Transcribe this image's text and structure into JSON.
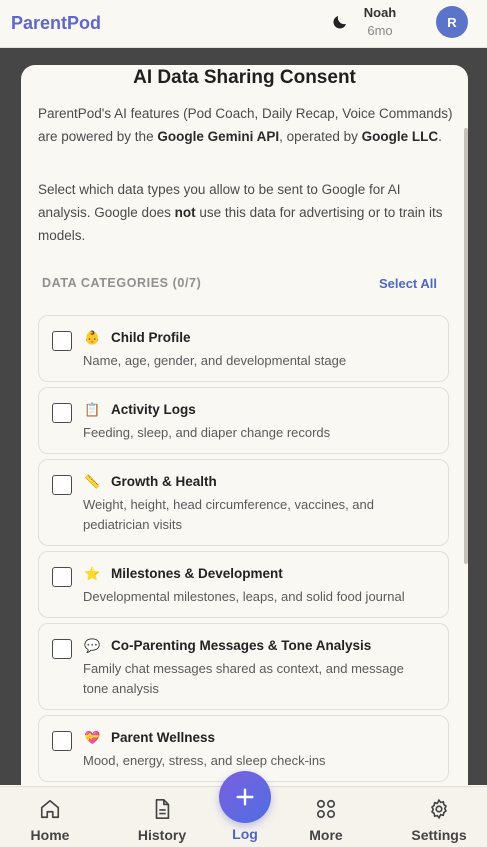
{
  "header": {
    "brand": "ParentPod",
    "user_name": "Noah",
    "child_age": "6mo",
    "avatar_initial": "R",
    "theme_icon": "moon-icon"
  },
  "modal": {
    "title": "AI Data Sharing Consent",
    "intro_pre": "ParentPod's AI features (Pod Coach, Daily Recap, Voice Commands) are powered by the ",
    "intro_api": "Google Gemini API",
    "intro_mid": ", operated by ",
    "intro_company": "Google LLC",
    "intro_end": ".",
    "select_pre": "Select which data types you allow to be sent to Google for AI analysis. Google does ",
    "select_not": "not",
    "select_post": " use this data for advertising or to train its models.",
    "categories_heading": "DATA CATEGORIES (0/7)",
    "select_all": "Select All",
    "categories": [
      {
        "emoji": "👶",
        "title": "Child Profile",
        "desc": "Name, age, gender, and developmental stage",
        "checked": false
      },
      {
        "emoji": "📋",
        "title": "Activity Logs",
        "desc": "Feeding, sleep, and diaper change records",
        "checked": false
      },
      {
        "emoji": "📏",
        "title": "Growth & Health",
        "desc": "Weight, height, head circumference, vaccines, and pediatrician visits",
        "checked": false
      },
      {
        "emoji": "⭐",
        "title": "Milestones & Development",
        "desc": "Developmental milestones, leaps, and solid food journal",
        "checked": false
      },
      {
        "emoji": "💬",
        "title": "Co-Parenting Messages & Tone Analysis",
        "desc": "Family chat messages shared as context, and message tone analysis",
        "checked": false
      },
      {
        "emoji": "💝",
        "title": "Parent Wellness",
        "desc": "Mood, energy, stress, and sleep check-ins",
        "checked": false
      }
    ]
  },
  "nav": {
    "home": "Home",
    "history": "History",
    "log": "Log",
    "more": "More",
    "settings": "Settings",
    "accent": "#4f64c4"
  }
}
